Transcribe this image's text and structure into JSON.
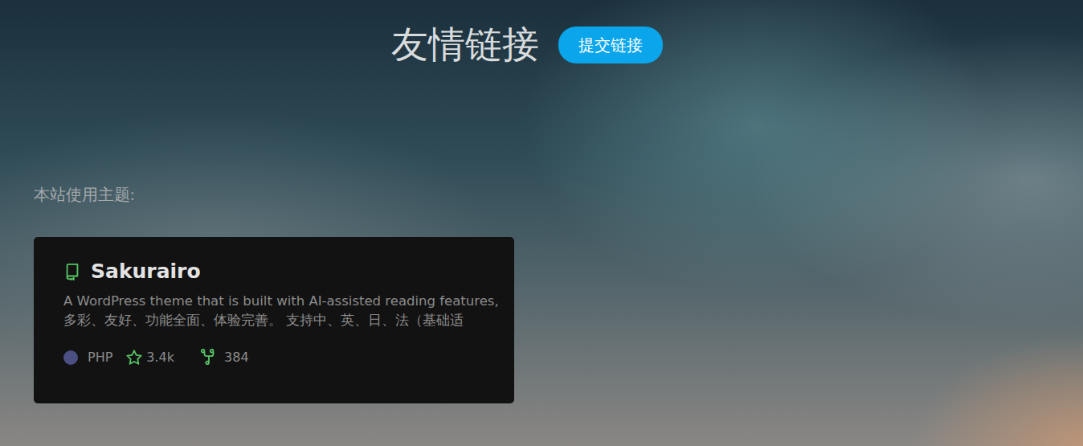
{
  "page": {
    "title": "友情链接",
    "submit_button": "提交链接",
    "theme_label": "本站使用主题:"
  },
  "repo_card": {
    "name": "Sakurairo",
    "description": [
      "A WordPress theme that is built with AI-assisted reading features,",
      "多彩、友好、功能全面、体验完善。 支持中、英、日、法（基础适"
    ],
    "language": "PHP",
    "stars": "3.4k",
    "forks": "384"
  }
}
